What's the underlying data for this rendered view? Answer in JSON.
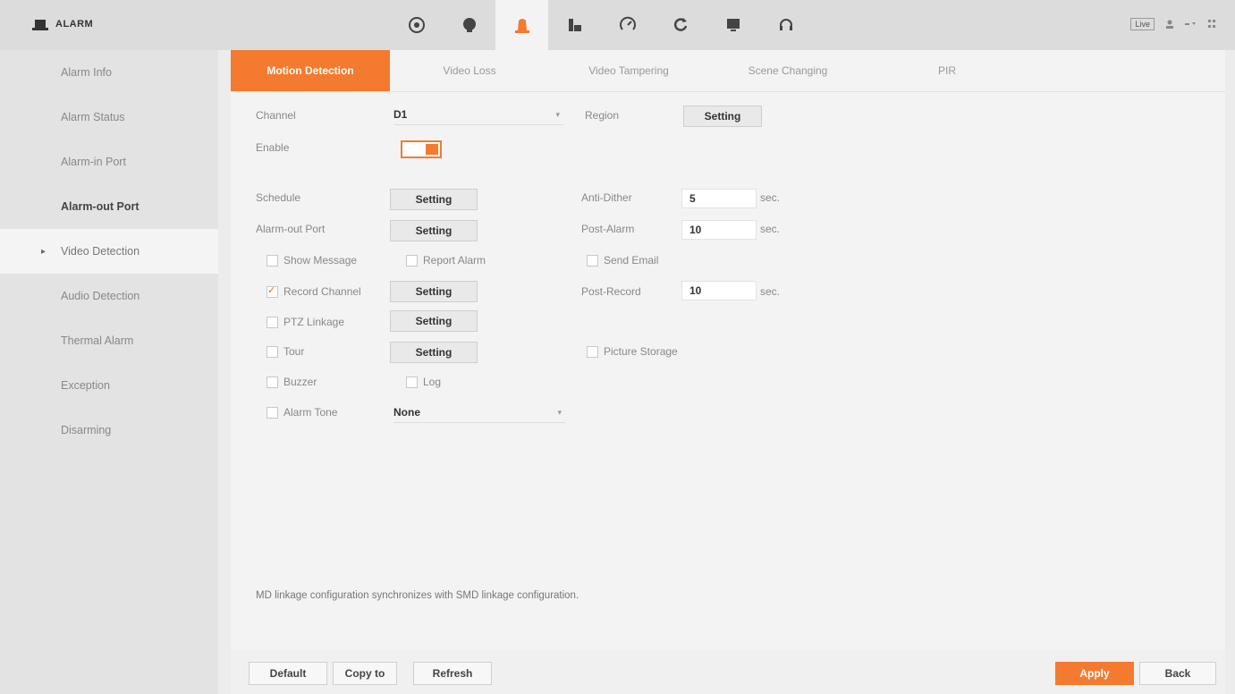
{
  "header": {
    "title": "ALARM",
    "modules": [
      {
        "icon": "gauge-icon"
      },
      {
        "icon": "camera-icon"
      },
      {
        "icon": "alarm-light-icon"
      },
      {
        "icon": "storage-icon"
      },
      {
        "icon": "network-icon"
      },
      {
        "icon": "refresh-icon"
      },
      {
        "icon": "monitor-icon"
      },
      {
        "icon": "headset-icon"
      }
    ],
    "live_label": "Live"
  },
  "sidebar": {
    "items": [
      {
        "label": "Alarm Info"
      },
      {
        "label": "Alarm Status"
      },
      {
        "label": "Alarm-in Port"
      },
      {
        "label": "Alarm-out Port"
      },
      {
        "label": "Video Detection"
      },
      {
        "label": "Audio Detection"
      },
      {
        "label": "Thermal Alarm"
      },
      {
        "label": "Exception"
      },
      {
        "label": "Disarming"
      }
    ]
  },
  "tabs": [
    "Motion Detection",
    "Video Loss",
    "Video Tampering",
    "Scene Changing",
    "PIR"
  ],
  "form": {
    "channel_label": "Channel",
    "channel_value": "D1",
    "region_label": "Region",
    "region_button": "Setting",
    "enable_label": "Enable",
    "schedule_label": "Schedule",
    "schedule_button": "Setting",
    "alarm_out_label": "Alarm-out Port",
    "alarm_out_button": "Setting",
    "anti_dither_label": "Anti-Dither",
    "anti_dither_value": "5",
    "post_alarm_label": "Post-Alarm",
    "post_alarm_value": "10",
    "sec": "sec.",
    "show_message": "Show Message",
    "report_alarm": "Report Alarm",
    "send_email": "Send Email",
    "record_channel": "Record Channel",
    "record_button": "Setting",
    "post_record_label": "Post-Record",
    "post_record_value": "10",
    "ptz_linkage": "PTZ Linkage",
    "ptz_button": "Setting",
    "tour": "Tour",
    "tour_button": "Setting",
    "picture_storage": "Picture Storage",
    "buzzer": "Buzzer",
    "log": "Log",
    "alarm_tone": "Alarm Tone",
    "alarm_tone_value": "None"
  },
  "note": "MD linkage configuration synchronizes with SMD linkage configuration.",
  "bottom": {
    "default": "Default",
    "copy_to": "Copy to",
    "refresh": "Refresh",
    "apply": "Apply",
    "back": "Back"
  },
  "colors": {
    "accent": "#f47a30"
  }
}
